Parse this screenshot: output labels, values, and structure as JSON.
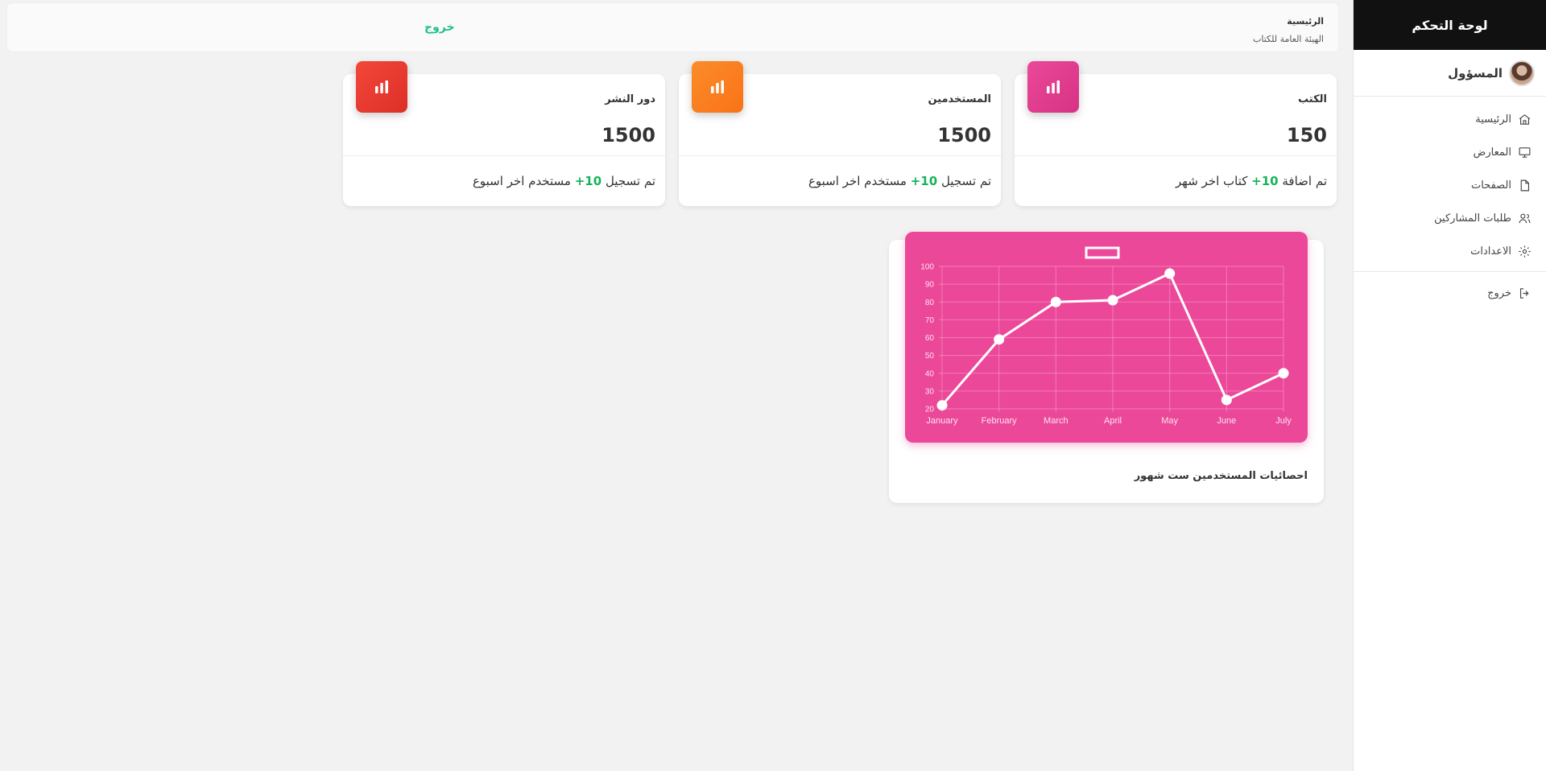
{
  "sidebar": {
    "title": "لوحة التحكم",
    "profile_name": "المسؤول",
    "items": [
      {
        "label": "الرئيسية",
        "icon": "home-icon"
      },
      {
        "label": "المعارض",
        "icon": "monitor-icon"
      },
      {
        "label": "الصفحات",
        "icon": "file-icon"
      },
      {
        "label": "طلبات المشاركين",
        "icon": "users-icon"
      },
      {
        "label": "الاعدادات",
        "icon": "gear-icon"
      }
    ],
    "logout": {
      "label": "خروج",
      "icon": "logout-icon"
    }
  },
  "topbar": {
    "breadcrumb_home": "الرئيسية",
    "org_name": "الهيئة العامة للكتاب",
    "logout_label": "خروج"
  },
  "cards": [
    {
      "title": "الكتب",
      "value": "150",
      "foot_before": "تم اضافة ",
      "foot_highlight": "+10",
      "foot_after": " كتاب اخر شهر",
      "icon": "bar-chart-icon",
      "color": "#ec4899"
    },
    {
      "title": "المستخدمين",
      "value": "1500",
      "foot_before": "تم تسجيل ",
      "foot_highlight": "+10",
      "foot_after": " مستخدم اخر اسبوع",
      "icon": "bar-chart-icon",
      "color": "#f97316"
    },
    {
      "title": "دور النشر",
      "value": "1500",
      "foot_before": "تم تسجيل ",
      "foot_highlight": "+10",
      "foot_after": " مستخدم اخر اسبوع",
      "icon": "bar-chart-icon",
      "color": "#ef3a2f"
    }
  ],
  "chart_caption": "احصائيات المستخدمين ست شهور",
  "chart_data": {
    "type": "line",
    "categories": [
      "January",
      "February",
      "March",
      "April",
      "May",
      "June",
      "July"
    ],
    "series": [
      {
        "values": [
          22,
          59,
          80,
          81,
          96,
          25,
          40
        ]
      }
    ],
    "ylim": [
      20,
      100
    ],
    "yticks": [
      20,
      30,
      40,
      50,
      60,
      70,
      80,
      90,
      100
    ],
    "grid": true,
    "legend": "top-center",
    "background": "#ec4899",
    "line_color": "#ffffff"
  }
}
